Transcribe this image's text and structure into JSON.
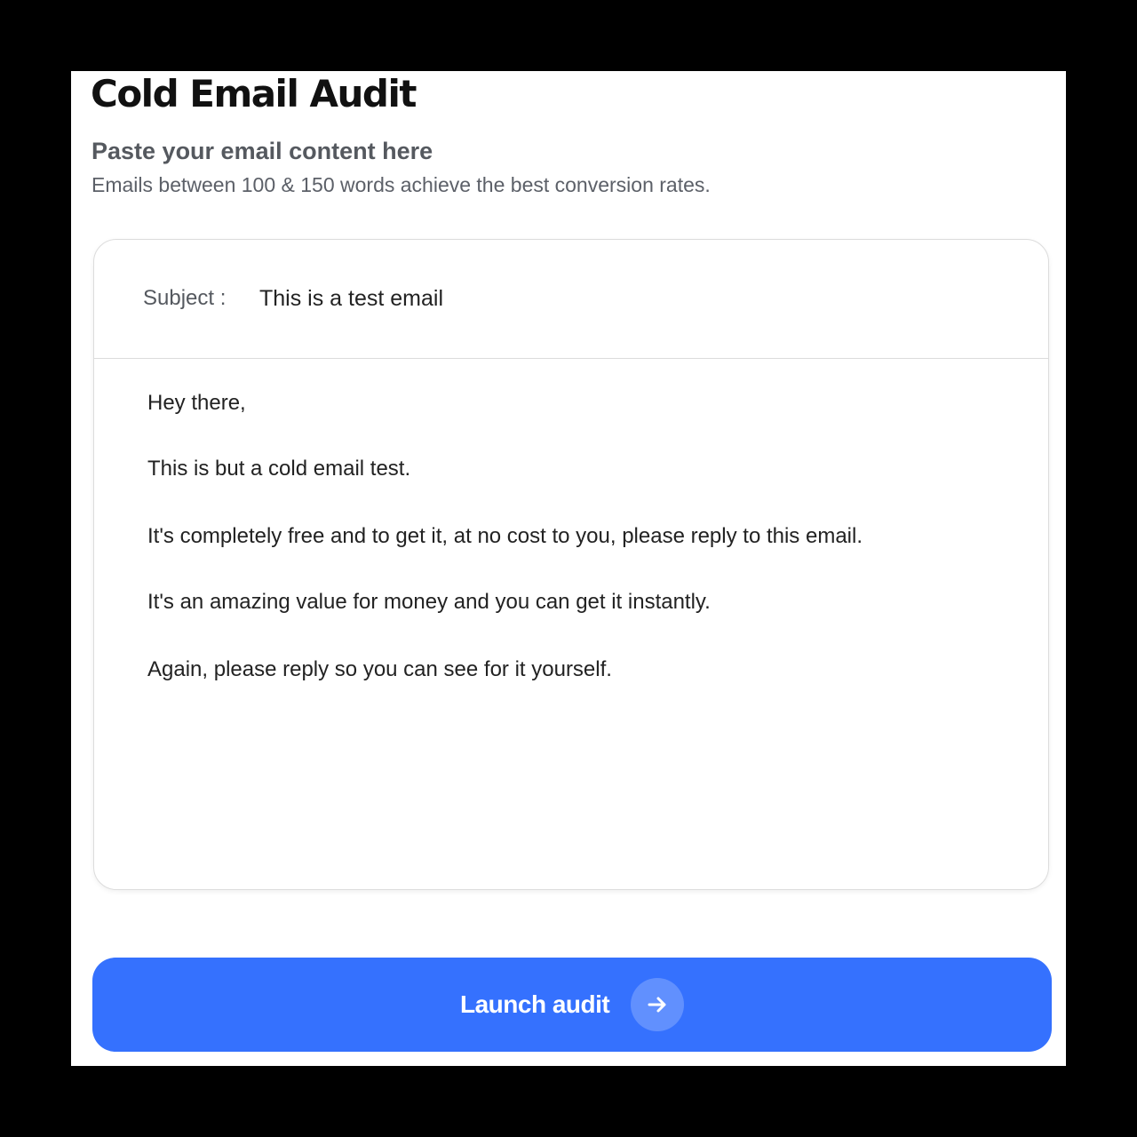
{
  "page": {
    "title": "Cold Email Audit",
    "subtitle": "Paste your email content here",
    "hint": "Emails between 100 & 150 words achieve the best conversion rates."
  },
  "email": {
    "subject_label": "Subject :",
    "subject_value": "This is a test email",
    "body_lines": [
      "Hey there,",
      "This is but a cold email test.",
      "It's completely free and to get it, at no cost to you, please reply to this email.",
      "It's an amazing value for money and you can get it instantly.",
      "Again, please reply so you can see for it yourself."
    ]
  },
  "actions": {
    "launch_label": "Launch audit",
    "launch_icon": "arrow-right-icon"
  },
  "colors": {
    "accent": "#3571fe",
    "background": "#ffffff",
    "frame": "#000000"
  }
}
